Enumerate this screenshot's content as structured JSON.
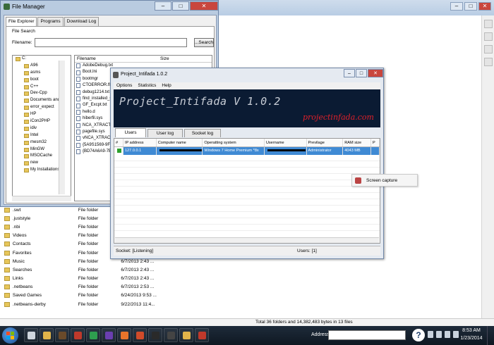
{
  "background_explorer": {
    "rows": [
      {
        "name": ".swt",
        "type": "File folder",
        "date": ""
      },
      {
        "name": ".juststyle",
        "type": "File folder",
        "date": ""
      },
      {
        "name": ".nbi",
        "type": "File folder",
        "date": ""
      },
      {
        "name": "Videos",
        "type": "File folder",
        "date": ""
      },
      {
        "name": "Contacts",
        "type": "File folder",
        "date": ""
      },
      {
        "name": "Favorites",
        "type": "File folder",
        "date": ""
      },
      {
        "name": "Music",
        "type": "File folder",
        "date": "6/7/2013 2:43 ..."
      },
      {
        "name": "Searches",
        "type": "File folder",
        "date": "6/7/2013 2:43 ..."
      },
      {
        "name": "Links",
        "type": "File folder",
        "date": "6/7/2013 2:43 ..."
      },
      {
        "name": ".netbeans",
        "type": "File folder",
        "date": "6/7/2013 2:53 ..."
      },
      {
        "name": "Saved Games",
        "type": "File folder",
        "date": "6/24/2013 9:53 ..."
      },
      {
        "name": ".netbeans-derby",
        "type": "File folder",
        "date": "9/22/2013 11:4..."
      }
    ],
    "status": "Total 36 folders and 14,382,483 bytes in 13 files"
  },
  "file_manager": {
    "title": "File Manager",
    "window_buttons": [
      "–",
      "□",
      "✕"
    ],
    "tabs": [
      "File Explorer",
      "Programs",
      "Download Log"
    ],
    "file_search_label": "File Search",
    "filename_label": "Filename:",
    "filename_value": "",
    "search_button": "...Search",
    "tree": [
      "C:",
      "A96",
      "asms",
      "boot",
      "C++",
      "Dev-Cpp",
      "Documents and S",
      "error_expect",
      "HP",
      "iCon2PHP",
      "idiv",
      "Intel",
      "mesm32",
      "MinGW",
      "MSOCache",
      "new",
      "My Installations"
    ],
    "list_header": {
      "filename": "Filename",
      "size": "Size"
    },
    "files": [
      "AdobeDebug.txt",
      "Boot.Ini",
      "bootmgr",
      "CTOERROR.flg",
      "debug1214.txt",
      "find_installed_sear",
      "GF_Excpt.txt",
      "hello.d",
      "hiberfil.sys",
      "NCA_XTRACT.SEC",
      "pagefile.sys",
      "vNCA_XTRACT.EX",
      "{5A9S1569-9F0A-",
      "{BD74A6A9-7B41-"
    ]
  },
  "intifada": {
    "title": "Project_Intifada 1.0.2",
    "window_buttons": [
      "–",
      "□",
      "✕"
    ],
    "menu": [
      "Options",
      "Statistics",
      "Help"
    ],
    "banner_title": "Project_Intifada V 1.0.2",
    "banner_subtitle": "projectinfada.com",
    "tabs": [
      "Users",
      "User log",
      "Socket log"
    ],
    "columns": [
      "#",
      "IP address",
      "Computer name",
      "Operatting system",
      "Username",
      "Previlage",
      "RAM size",
      "P"
    ],
    "row": {
      "ip": "127.0.0.1",
      "os": "Windows 7 Home Premium *8x",
      "privilege": "Administrator",
      "ram": "4043 MB"
    },
    "status_socket": "Socket: [Listening]",
    "status_users": "Users:  [1]",
    "colors": {
      "banner_bg": "#0b1b33",
      "banner_accent": "#e0202a",
      "selected_row": "#3f8ad4"
    }
  },
  "context_menu": {
    "item": "Screen capture"
  },
  "taskbar": {
    "address_label": "Address",
    "address_value": "",
    "time": "8:53 AM",
    "date": "1/23/2014",
    "apps": [
      "window-app",
      "folder-app",
      "media-app",
      "paint-app",
      "chrome-app",
      "visual-studio-app",
      "firefox-app",
      "java-app",
      "intifada-app",
      "cmd-app",
      "explorer-app",
      "flag-app"
    ]
  }
}
